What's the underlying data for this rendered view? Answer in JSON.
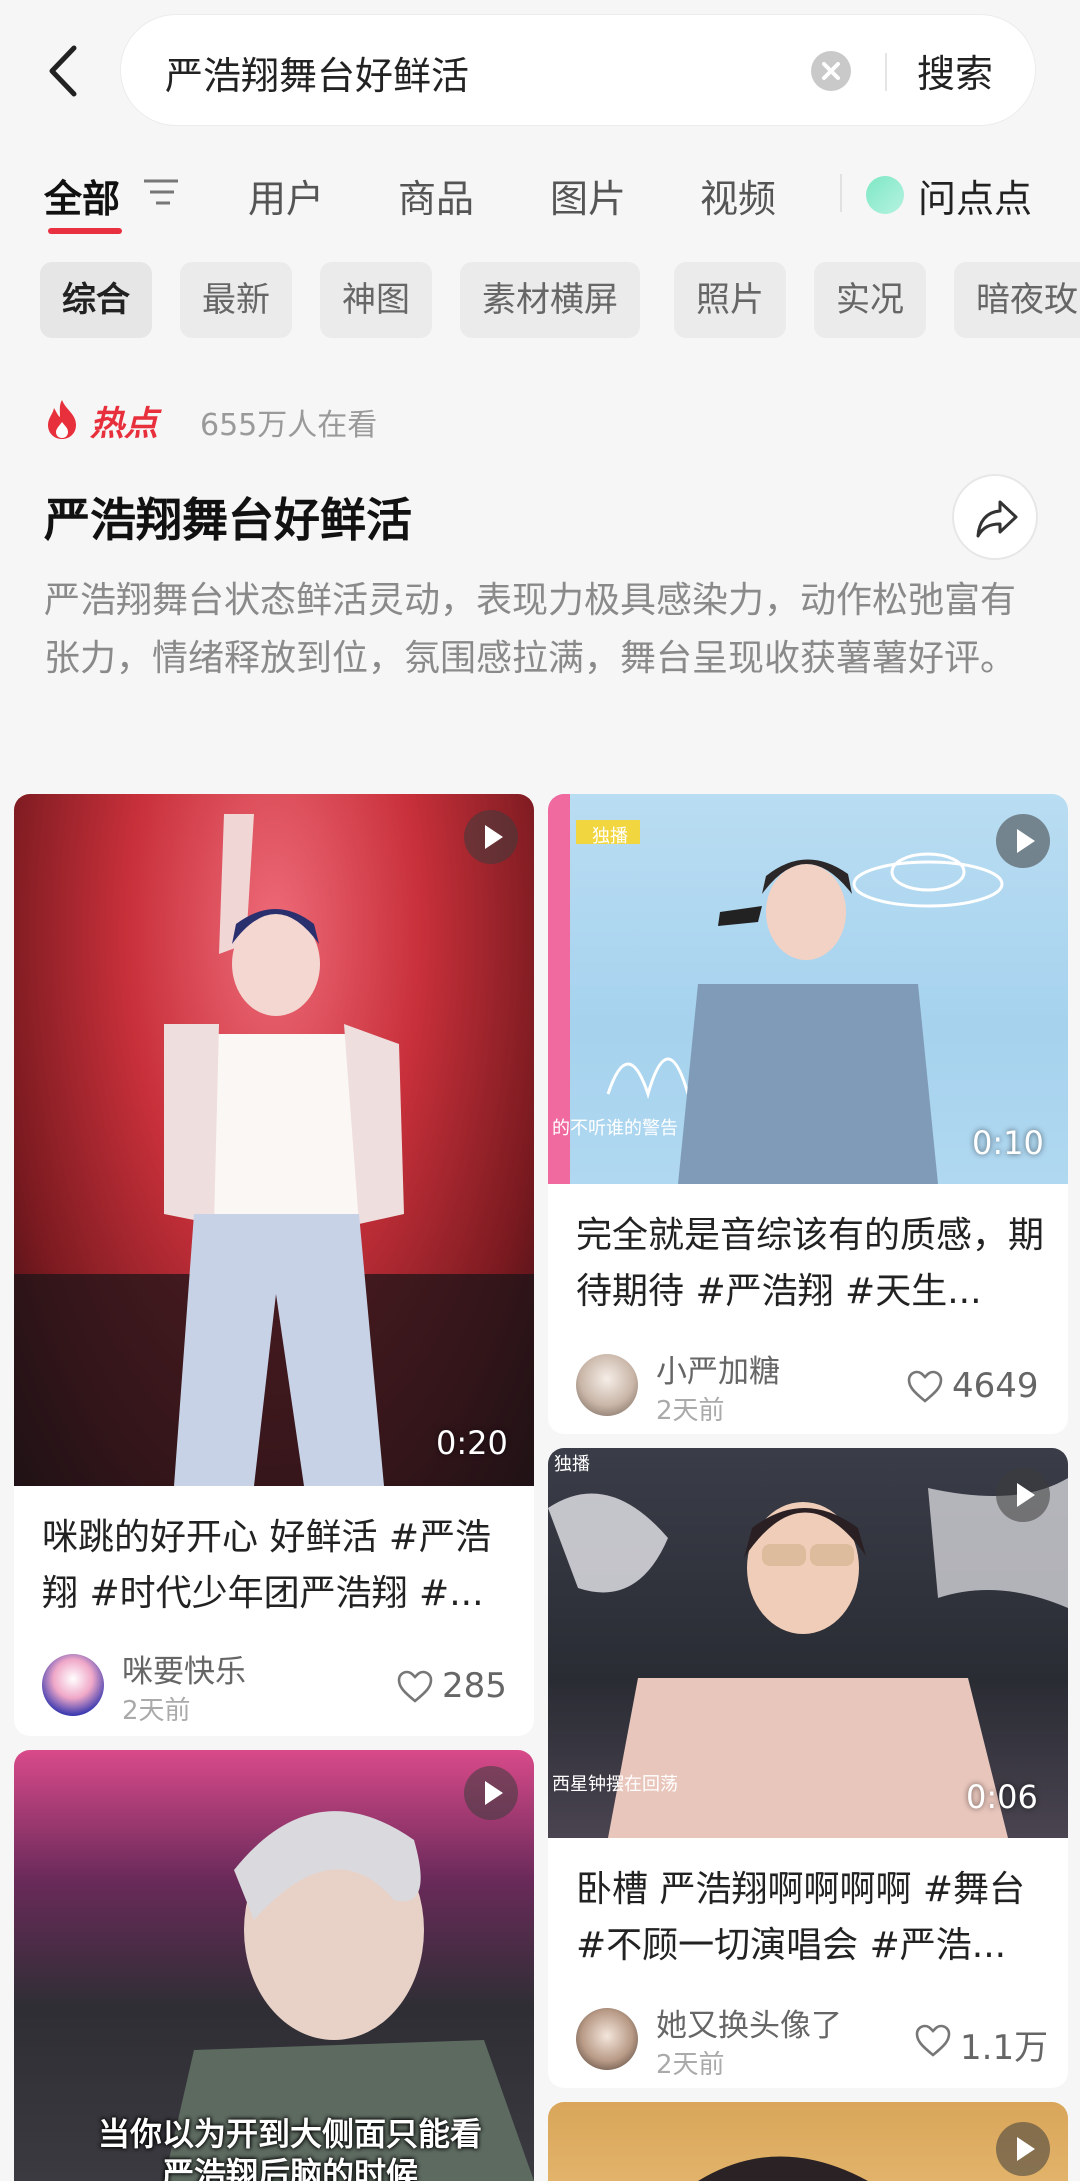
{
  "search": {
    "query": "严浩翔舞台好鲜活",
    "button": "搜索"
  },
  "tabs": [
    {
      "label": "全部"
    },
    {
      "label": "用户"
    },
    {
      "label": "商品"
    },
    {
      "label": "图片"
    },
    {
      "label": "视频"
    },
    {
      "label": "问点点"
    }
  ],
  "chips": [
    "综合",
    "最新",
    "神图",
    "素材横屏",
    "照片",
    "实况",
    "暗夜玫"
  ],
  "hot": {
    "label": "热点",
    "count": "655万人在看"
  },
  "topic": {
    "title": "严浩翔舞台好鲜活",
    "description": "严浩翔舞台状态鲜活灵动，表现力极具感染力，动作松弛富有张力，情绪释放到位，氛围感拉满，舞台呈现收获薯薯好评。"
  },
  "cards": [
    {
      "duration": "0:20",
      "title": "咪跳的好开心 好鲜活 #严浩翔 #时代少年团严浩翔 #...",
      "author": "咪要快乐",
      "time": "2天前",
      "likes": "285"
    },
    {
      "duration": "0:10",
      "title": "完全就是音综该有的质感，期待期待 #严浩翔 #天生...",
      "author": "小严加糖",
      "time": "2天前",
      "likes": "4649",
      "overlay_tag": "独播",
      "caption": "的不听谁的警告"
    },
    {
      "duration": "0:06",
      "title": "卧槽 严浩翔啊啊啊啊 #舞台 #不顾一切演唱会 #严浩...",
      "author": "她又换头像了",
      "time": "2天前",
      "likes": "1.1万",
      "overlay_tag": "独播",
      "caption": "西星钟摆在回荡"
    },
    {
      "caption": "当你以为开到大侧面只能看严浩翔后脑的时候"
    }
  ],
  "colors": {
    "accent": "#e83040",
    "hot": "#e8303d"
  }
}
